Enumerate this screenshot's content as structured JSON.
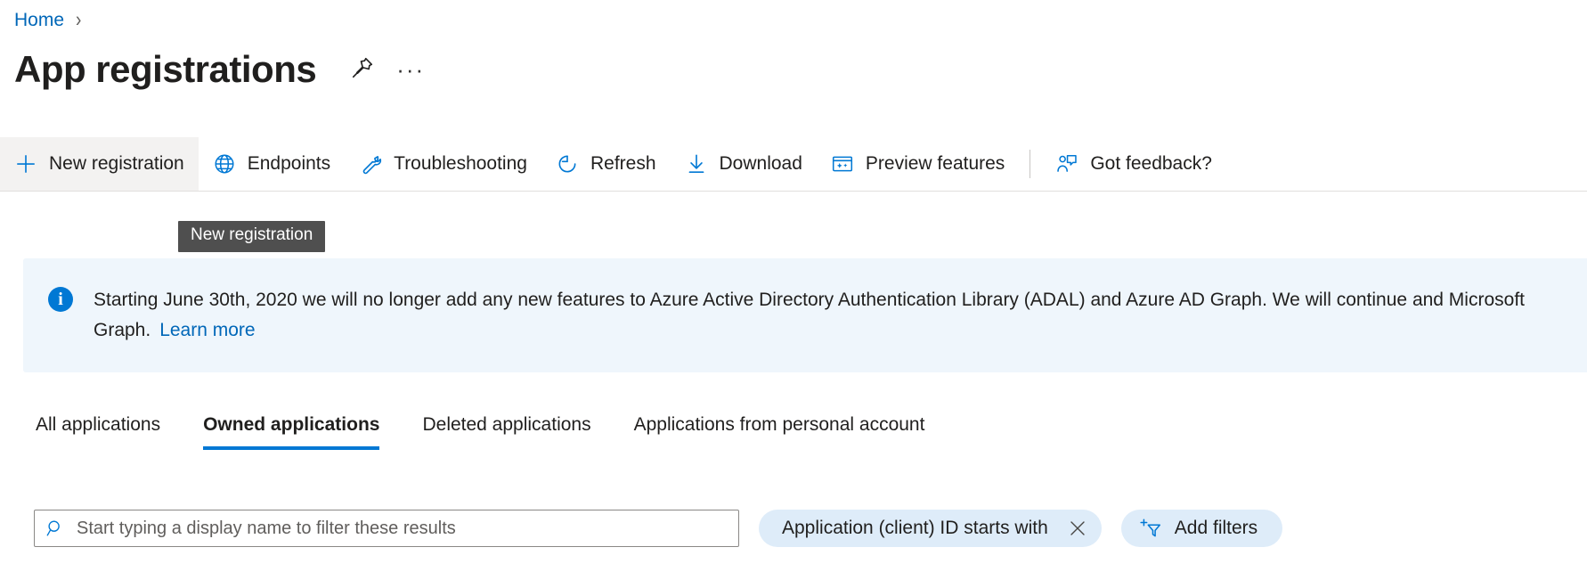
{
  "breadcrumb": {
    "home_label": "Home",
    "separator": "›"
  },
  "header": {
    "title": "App registrations",
    "pin_icon": "pin-icon",
    "more_icon": "ellipsis-icon",
    "more_label": "···"
  },
  "command_bar": {
    "items": [
      {
        "label": "New registration",
        "icon": "plus-icon",
        "hovered": true
      },
      {
        "label": "Endpoints",
        "icon": "globe-icon",
        "hovered": false
      },
      {
        "label": "Troubleshooting",
        "icon": "wrench-icon",
        "hovered": false
      },
      {
        "label": "Refresh",
        "icon": "refresh-icon",
        "hovered": false
      },
      {
        "label": "Download",
        "icon": "download-icon",
        "hovered": false
      },
      {
        "label": "Preview features",
        "icon": "preview-features-icon",
        "hovered": false
      },
      {
        "label": "Got feedback?",
        "icon": "feedback-icon",
        "hovered": false
      }
    ]
  },
  "tooltip": {
    "text": "New registration"
  },
  "info_banner": {
    "icon": "info-icon",
    "text": "Starting June 30th, 2020 we will no longer add any new features to Azure Active Directory Authentication Library (ADAL) and Azure AD Graph. We will continue and Microsoft Graph.",
    "line1": "Starting June 30th, 2020 we will no longer add any new features to Azure Active Directory Authentication Library (ADAL) and Azure AD Graph. We will continue",
    "line2": "and Microsoft Graph.",
    "link_label": "Learn more"
  },
  "tabs": [
    {
      "label": "All applications",
      "active": false
    },
    {
      "label": "Owned applications",
      "active": true
    },
    {
      "label": "Deleted applications",
      "active": false
    },
    {
      "label": "Applications from personal account",
      "active": false
    }
  ],
  "filters": {
    "search": {
      "icon": "search-icon",
      "value": "",
      "placeholder": "Start typing a display name to filter these results"
    },
    "active_filter": {
      "label": "Application (client) ID starts with",
      "remove_icon": "close-icon"
    },
    "add_filters": {
      "label": "Add filters",
      "icon": "add-filter-icon"
    }
  },
  "colors": {
    "accent": "#0078d4",
    "link": "#0067b8",
    "banner_bg": "#eff6fc",
    "pill_bg": "#deecf9",
    "tooltip_bg": "#4f4f4f",
    "hover_bg": "#f3f2f1"
  }
}
